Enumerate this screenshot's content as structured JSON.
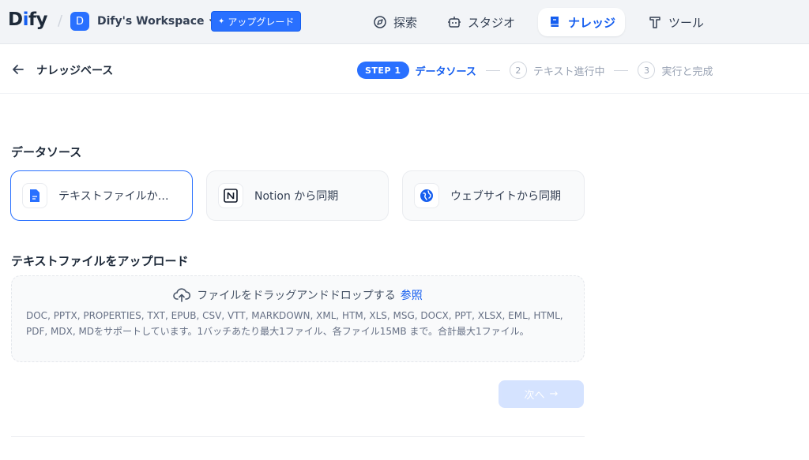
{
  "topbar": {
    "logo": "Dify",
    "workspace": {
      "initial": "D",
      "name": "Dify's Workspace"
    },
    "upgrade_label": "アップグレード",
    "nav": [
      {
        "label": "探索",
        "icon": "compass-icon"
      },
      {
        "label": "スタジオ",
        "icon": "robot-icon"
      },
      {
        "label": "ナレッジ",
        "icon": "book-icon",
        "active": true
      },
      {
        "label": "ツール",
        "icon": "hammer-icon"
      }
    ]
  },
  "header": {
    "title": "ナレッジベース",
    "steps": [
      {
        "badge": "STEP 1",
        "label": "データソース",
        "active": true
      },
      {
        "number": "2",
        "label": "テキスト進行中"
      },
      {
        "number": "3",
        "label": "実行と完成"
      }
    ]
  },
  "datasource": {
    "title": "データソース",
    "options": [
      {
        "label": "テキストファイルか…",
        "icon": "file-text-icon",
        "selected": true
      },
      {
        "label": "Notion から同期",
        "icon": "notion-icon"
      },
      {
        "label": "ウェブサイトから同期",
        "icon": "globe-icon"
      }
    ]
  },
  "upload": {
    "title": "テキストファイルをアップロード",
    "drop_text": "ファイルをドラッグアンドドロップする",
    "browse_link": "参照",
    "hint": "DOC, PPTX, PROPERTIES, TXT, EPUB, CSV, VTT, MARKDOWN, XML, HTM, XLS, MSG, DOCX, PPT, XLSX, EML, HTML, PDF, MDX, MDをサポートしています。1バッチあたり最大1ファイル、各ファイル15MB まで。合計最大1ファイル。"
  },
  "next_button": {
    "label": "次へ",
    "enabled": false
  },
  "colors": {
    "accent": "#155eef",
    "accent_light": "#2970ff",
    "disabled_button": "#d1e0ff"
  }
}
